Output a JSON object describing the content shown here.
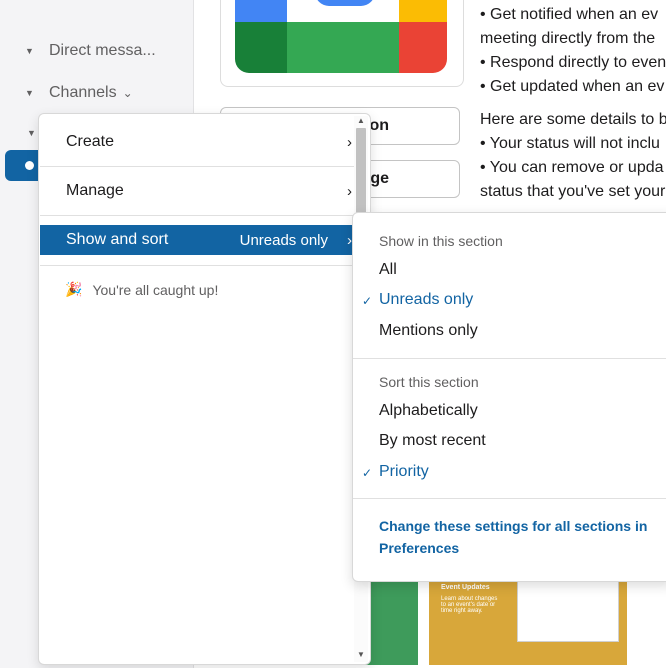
{
  "sidebar": {
    "direct_messages": "Direct messa...",
    "channels": "Channels"
  },
  "background": {
    "button_1_partial": "ion",
    "button_2_partial": "page",
    "message_lines": [
      "• Get notified when an ev",
      "meeting directly from the",
      "• Respond directly to even",
      "• Get updated when an ev",
      "Here are some details to b",
      "• Your status will not inclu",
      "• You can remove or upda",
      "status that you've set your"
    ],
    "thumb_event_title": "Event Updates",
    "thumb_event_body": "Learn about changes to an event's date or time right away."
  },
  "menu": {
    "create": "Create",
    "manage": "Manage",
    "show_and_sort": "Show and sort",
    "show_and_sort_value": "Unreads only",
    "caught_up": "You're all caught up!"
  },
  "submenu": {
    "show_header": "Show in this section",
    "show_options": [
      "All",
      "Unreads only",
      "Mentions only"
    ],
    "sort_header": "Sort this section",
    "sort_options": [
      "Alphabetically",
      "By most recent",
      "Priority"
    ],
    "change_link": "Change these settings for all sections in Preferences"
  }
}
